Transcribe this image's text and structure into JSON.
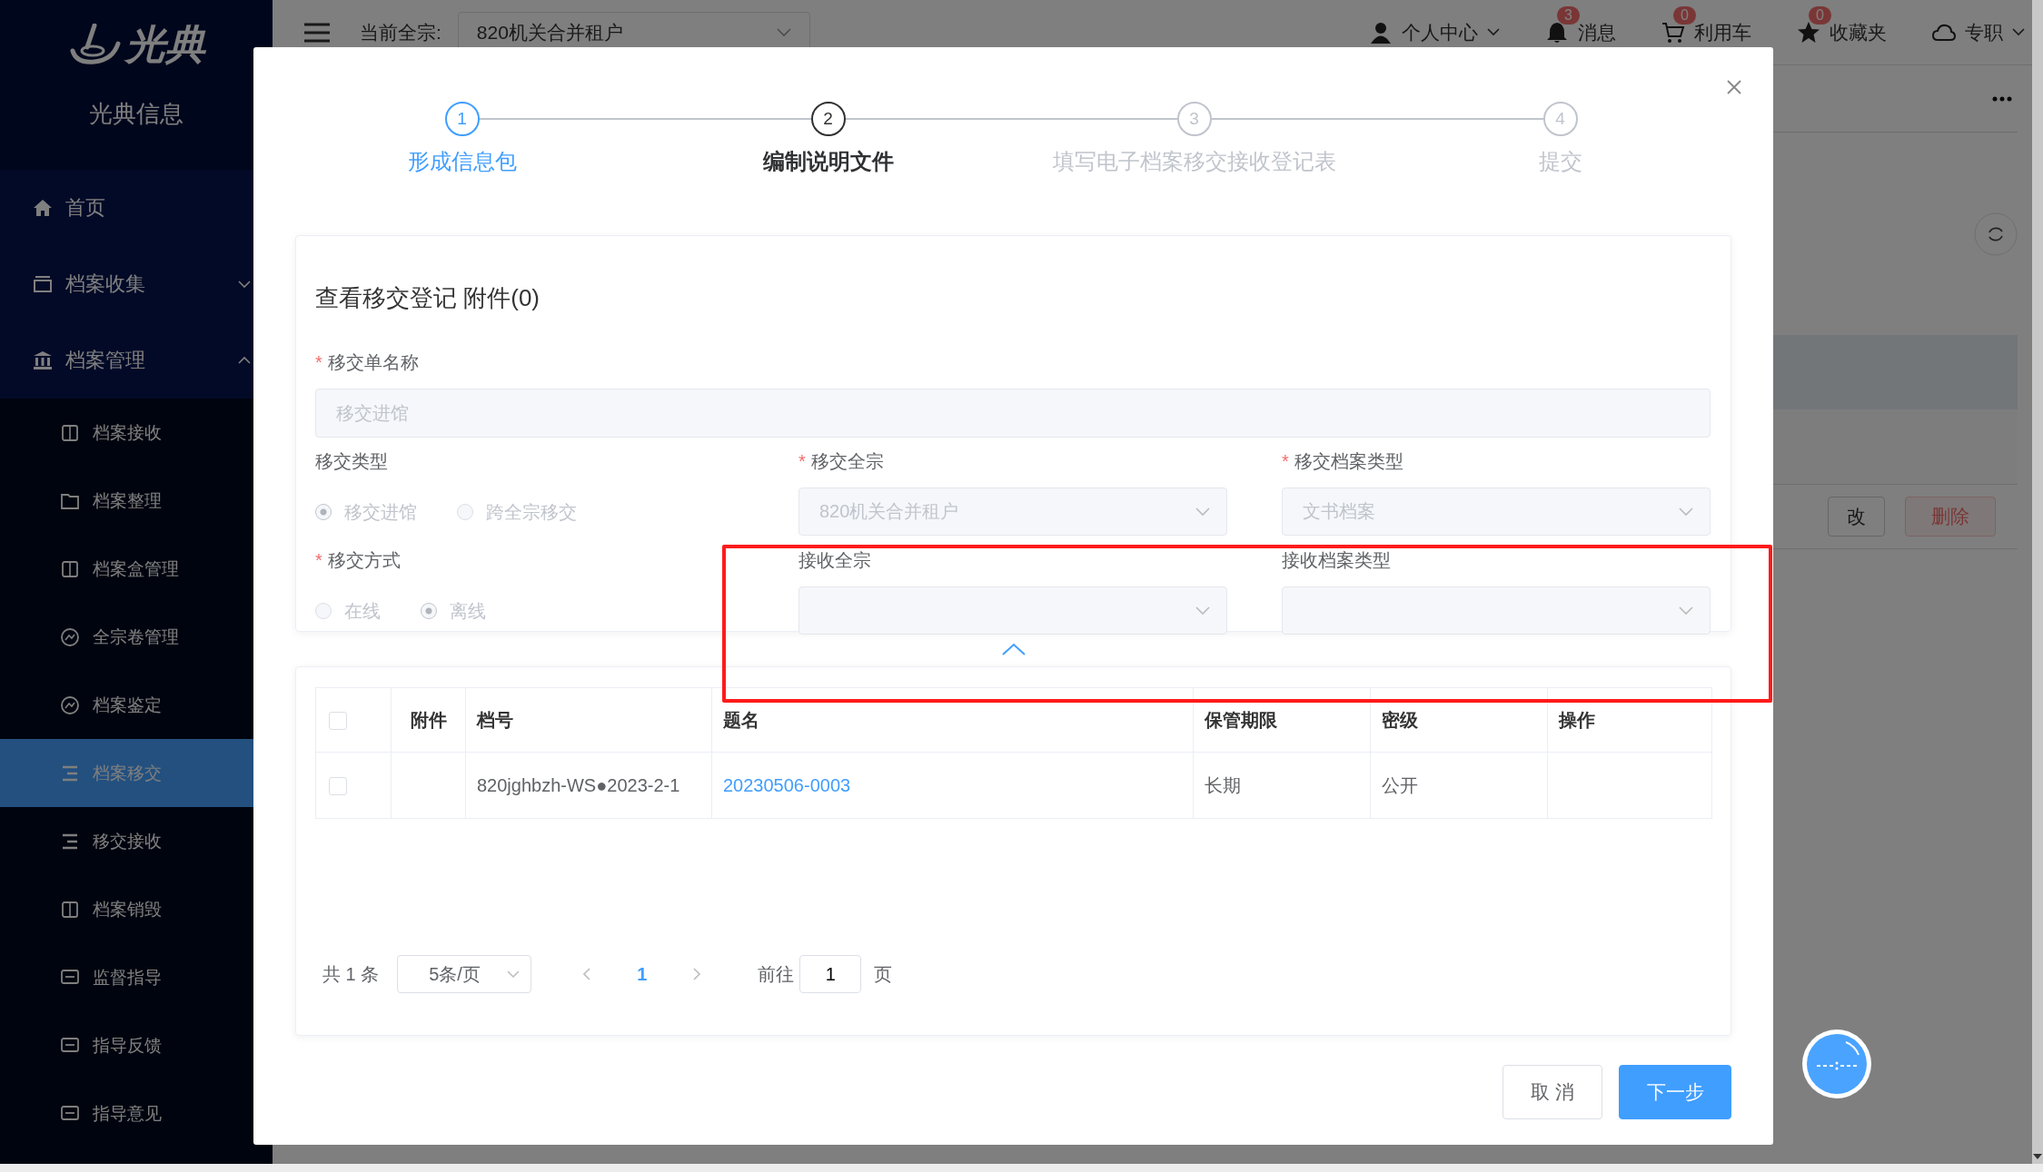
{
  "sidebar": {
    "logo_text": "光典",
    "brand": "光典信息",
    "items": [
      {
        "label": "首页",
        "selected": false
      },
      {
        "label": "档案收集",
        "selected": false,
        "expanded": false
      },
      {
        "label": "档案管理",
        "selected": false,
        "expanded": true,
        "children": [
          {
            "label": "档案接收",
            "selected": false
          },
          {
            "label": "档案整理",
            "selected": false
          },
          {
            "label": "档案盒管理",
            "selected": false
          },
          {
            "label": "全宗卷管理",
            "selected": false
          },
          {
            "label": "档案鉴定",
            "selected": false
          },
          {
            "label": "档案移交",
            "selected": true
          },
          {
            "label": "移交接收",
            "selected": false
          },
          {
            "label": "档案销毁",
            "selected": false
          },
          {
            "label": "监督指导",
            "selected": false
          },
          {
            "label": "指导反馈",
            "selected": false
          },
          {
            "label": "指导意见",
            "selected": false
          }
        ]
      }
    ]
  },
  "topbar": {
    "fonds_label": "当前全宗:",
    "fonds_value": "820机关合并租户",
    "actions": [
      {
        "label": "个人中心",
        "dropdown": true
      },
      {
        "label": "消息",
        "badge": "3"
      },
      {
        "label": "利用车",
        "badge": "0"
      },
      {
        "label": "收藏夹",
        "badge": "0"
      },
      {
        "label": "专职",
        "dropdown": true
      }
    ]
  },
  "background_page": {
    "buttons": [
      {
        "label": "改",
        "kind": "default"
      },
      {
        "label": "删除",
        "kind": "danger"
      }
    ]
  },
  "dialog": {
    "steps": [
      {
        "number": "1",
        "label": "形成信息包",
        "completed": true,
        "selected": false
      },
      {
        "number": "2",
        "label": "编制说明文件",
        "completed": false,
        "selected": true
      },
      {
        "number": "3",
        "label": "填写电子档案移交接收登记表",
        "completed": false,
        "selected": false
      },
      {
        "number": "4",
        "label": "提交",
        "completed": false,
        "selected": false
      }
    ],
    "form": {
      "title": "查看移交登记 附件(0)",
      "fields": [
        {
          "kind": "text",
          "label": "移交单名称",
          "required_mark": "*",
          "disabled": true,
          "value": "移交进馆"
        },
        {
          "kind": "radio",
          "label": "移交类型",
          "disabled": true,
          "options": [
            {
              "label": "移交进馆",
              "selected": true
            },
            {
              "label": "跨全宗移交",
              "selected": false
            }
          ]
        },
        {
          "kind": "select",
          "label": "移交全宗",
          "required_mark": "*",
          "disabled": true,
          "value": "820机关合并租户"
        },
        {
          "kind": "select",
          "label": "移交档案类型",
          "required_mark": "*",
          "disabled": true,
          "value": "文书档案"
        },
        {
          "kind": "radio",
          "label": "移交方式",
          "required_mark": "*",
          "disabled": true,
          "options": [
            {
              "label": "在线",
              "selected": false
            },
            {
              "label": "离线",
              "selected": true
            }
          ]
        },
        {
          "kind": "select",
          "label": "接收全宗",
          "disabled": true
        },
        {
          "kind": "select",
          "label": "接收档案类型",
          "disabled": true
        }
      ]
    },
    "table": {
      "all_checked": false,
      "columns": [
        "附件",
        "档号",
        "题名",
        "保管期限",
        "密级",
        "操作"
      ],
      "rows": [
        {
          "checked": false,
          "archive_no": "820jghbzh-WS●2023-2-1",
          "title": "20230506-0003",
          "retention": "长期",
          "security": "公开"
        }
      ]
    },
    "pagination": {
      "total": "共 1 条",
      "page_size": "5条/页",
      "pages": [
        {
          "label": "1",
          "selected": true
        }
      ],
      "goto_label": "前往",
      "goto_value": "1",
      "goto_suffix": "页"
    },
    "buttons": [
      {
        "label": "取 消",
        "kind": "default"
      },
      {
        "label": "下一步",
        "kind": "primary"
      }
    ]
  }
}
